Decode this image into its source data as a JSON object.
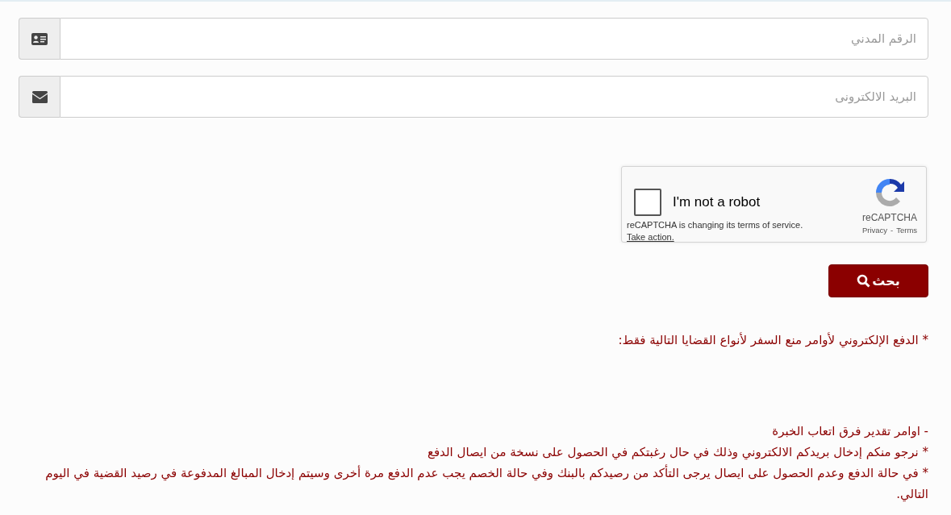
{
  "fields": [
    {
      "kind": "id-card",
      "placeholder": "الرقم المدني"
    },
    {
      "kind": "email",
      "placeholder": "البريد الالكترونى"
    }
  ],
  "captcha": {
    "checked": false,
    "label": "I'm not a robot",
    "notice": "reCAPTCHA is changing its terms of service.",
    "notice_link": "Take action.",
    "brand": "reCAPTCHA",
    "privacy": "Privacy",
    "separator": "-",
    "terms": "Terms"
  },
  "search_button": {
    "label": "بحث"
  },
  "notes": [
    {
      "text": "* الدفع الإلكتروني لأوامر منع السفر لأنواع القضايا التالية فقط:"
    },
    {
      "text": "- اوامر تقدير فرق اتعاب الخبرة"
    },
    {
      "text": "* نرجو منكم إدخال بريدكم الالكتروني وذلك في حال رغبتكم في الحصول على نسخة من ايصال الدفع"
    },
    {
      "text": "* في حالة الدفع وعدم الحصول على ايصال يرجى التأكد من رصيدكم بالبنك وفي حالة الخصم يجب عدم الدفع مرة أخرى وسيتم إدخال المبالغ المدفوعة في رصيد القضية في اليوم التالي."
    }
  ]
}
